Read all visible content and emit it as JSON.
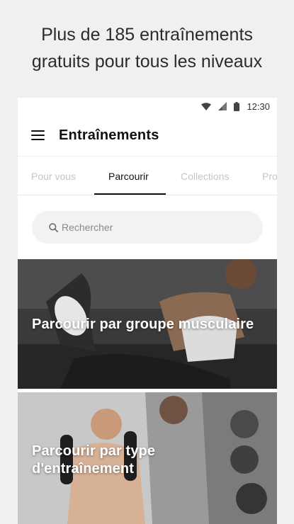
{
  "promo": {
    "line1": "Plus de 185 entraînements",
    "line2": "gratuits pour tous les niveaux"
  },
  "status_bar": {
    "time": "12:30",
    "icons": [
      "wifi-icon",
      "cellular-signal-icon",
      "battery-icon"
    ]
  },
  "app_bar": {
    "menu_icon": "hamburger-menu-icon",
    "title": "Entraînements"
  },
  "tabs": [
    {
      "label": "Pour vous",
      "active": false
    },
    {
      "label": "Parcourir",
      "active": true
    },
    {
      "label": "Collections",
      "active": false
    },
    {
      "label": "Pro",
      "active": false
    }
  ],
  "search": {
    "icon": "search-icon",
    "placeholder": "Rechercher"
  },
  "cards": [
    {
      "label": "Parcourir par groupe musculaire"
    },
    {
      "label": "Parcourir par type d'entraînement"
    }
  ],
  "colors": {
    "background": "#f0f0f0",
    "surface": "#ffffff",
    "text_primary": "#111111",
    "text_inactive": "#c5c5c5",
    "search_fill": "#f2f2f2"
  }
}
